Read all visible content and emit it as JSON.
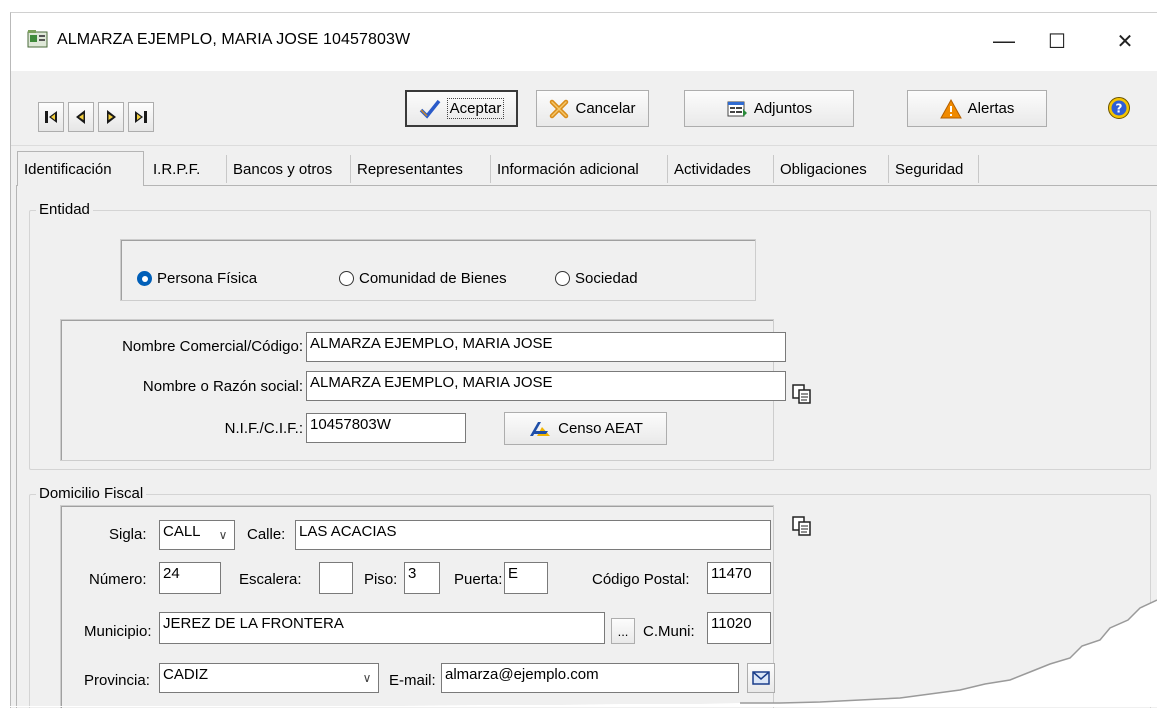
{
  "window": {
    "title": "ALMARZA EJEMPLO, MARIA JOSE  10457803W",
    "controls": {
      "minimize": "—",
      "maximize": "☐",
      "close": "✕"
    }
  },
  "toolbar": {
    "accept_label": "Aceptar",
    "cancel_label": "Cancelar",
    "attachments_label": "Adjuntos",
    "alerts_label": "Alertas"
  },
  "tabs": [
    "Identificación",
    "I.R.P.F.",
    "Bancos y otros",
    "Representantes",
    "Información adicional",
    "Actividades",
    "Obligaciones",
    "Seguridad"
  ],
  "entidad": {
    "legend": "Entidad",
    "radios": [
      {
        "label": "Persona Física",
        "selected": true
      },
      {
        "label": "Comunidad de Bienes",
        "selected": false
      },
      {
        "label": "Sociedad",
        "selected": false
      }
    ],
    "nombre_comercial_label": "Nombre Comercial/Código:",
    "nombre_comercial_value": "ALMARZA EJEMPLO, MARIA JOSE",
    "razon_social_label": "Nombre o Razón social:",
    "razon_social_value": "ALMARZA EJEMPLO, MARIA JOSE",
    "nif_label": "N.I.F./C.I.F.:",
    "nif_value": "10457803W",
    "censo_label": "Censo AEAT"
  },
  "domicilio": {
    "legend": "Domicilio Fiscal",
    "sigla_label": "Sigla:",
    "sigla_value": "CALL",
    "calle_label": "Calle:",
    "calle_value": "LAS ACACIAS",
    "numero_label": "Número:",
    "numero_value": "24",
    "escalera_label": "Escalera:",
    "escalera_value": "",
    "piso_label": "Piso:",
    "piso_value": "3",
    "puerta_label": "Puerta:",
    "puerta_value": "E",
    "cp_label": "Código Postal:",
    "cp_value": "11470",
    "municipio_label": "Municipio:",
    "municipio_value": "JEREZ DE LA FRONTERA",
    "browse_label": "...",
    "cmuni_label": "C.Muni:",
    "cmuni_value": "11020",
    "provincia_label": "Provincia:",
    "provincia_value": "CADIZ",
    "email_label": "E-mail:",
    "email_value": "almarza@ejemplo.com"
  },
  "colors": {
    "accent": "#005fb8",
    "window_bg": "#f0f0f0"
  }
}
